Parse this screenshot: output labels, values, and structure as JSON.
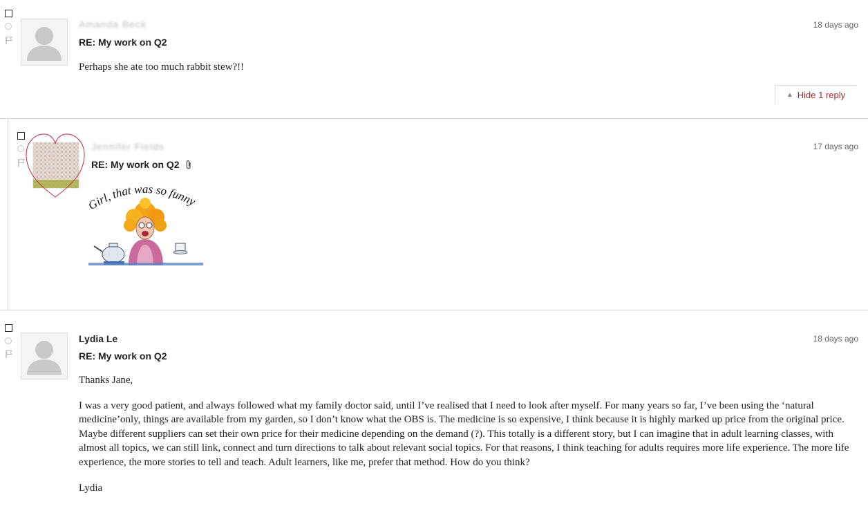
{
  "posts": [
    {
      "author": "Amanda Beck",
      "subject": "RE: My work on Q2",
      "time": "18 days ago",
      "body": [
        "Perhaps she ate too much rabbit stew?!!"
      ],
      "hide_replies_label": "Hide 1 reply"
    },
    {
      "author": "Jennifer Fields",
      "subject": "RE: My work on Q2",
      "time": "17 days ago",
      "has_attachment": true,
      "image_caption": "Girl, that was so funny"
    },
    {
      "author": "Lydia Le",
      "subject": "RE: My work on Q2",
      "time": "18 days ago",
      "body": [
        "Thanks Jane,",
        "I was a very good patient, and always followed what my family doctor said, until I’ve realised that I need to look after myself. For many years so far, I’ve been using the ‘natural medicine’only, things are available from my garden, so I don’t know what the OBS is. The medicine is so expensive, I think because it is highly marked up price from the original price. Maybe different suppliers can set their own price for their medicine depending on the demand (?). This totally is a different story, but I can imagine that in adult learning classes, with almost all topics, we can still link, connect and turn directions to talk about relevant social topics. For that reasons, I think teaching for adults requires more life experience. The more life experience, the more stories to tell and teach. Adult learners, like me, prefer that method. How do you think?",
        "Lydia"
      ]
    }
  ],
  "icons": {
    "checkbox": "checkbox-icon",
    "radio": "radio-icon",
    "flag": "flag-icon",
    "attachment": "paperclip-icon",
    "collapse": "triangle-up-icon"
  },
  "colors": {
    "hide_link": "#a0282c",
    "divider": "#d6d6d6",
    "meta_text": "#666666"
  }
}
